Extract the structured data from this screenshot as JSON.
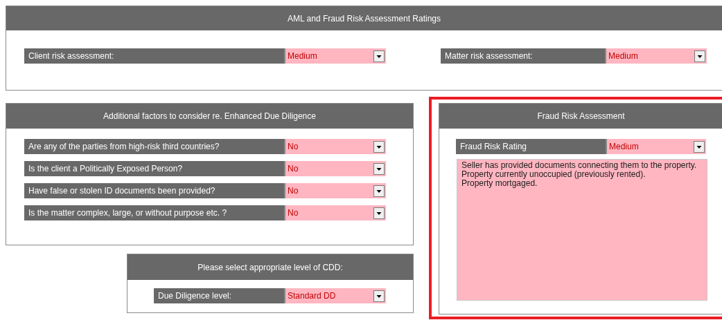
{
  "ratings_panel": {
    "title": "AML and Fraud Risk Assessment Ratings",
    "fields": [
      {
        "label": "Client risk assessment:",
        "value": "Medium"
      },
      {
        "label": "Matter risk assessment:",
        "value": "Medium"
      }
    ]
  },
  "edd_panel": {
    "title": "Additional factors to consider re. Enhanced Due Diligence",
    "fields": [
      {
        "label": "Are any of the parties from high-risk third countries?",
        "value": "No"
      },
      {
        "label": "Is the client a Politically Exposed Person?",
        "value": "No"
      },
      {
        "label": "Have false or stolen ID documents been provided?",
        "value": "No"
      },
      {
        "label": "Is the matter complex, large, or without purpose etc. ?",
        "value": "No"
      }
    ]
  },
  "cdd_panel": {
    "title": "Please select appropriate level of CDD:",
    "fields": [
      {
        "label": "Due Diligence level:",
        "value": "Standard DD"
      }
    ]
  },
  "fraud_panel": {
    "title": "Fraud Risk Assessment",
    "highlighted": true,
    "fields": [
      {
        "label": "Fraud Risk Rating",
        "value": "Medium"
      }
    ],
    "notes": "Seller has provided documents connecting them to the property.\nProperty currently unoccupied (previously rented).\nProperty mortgaged."
  }
}
